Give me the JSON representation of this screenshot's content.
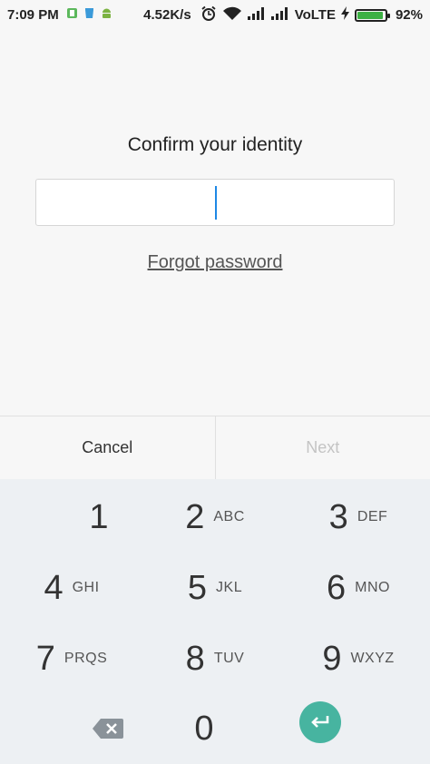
{
  "status_bar": {
    "time": "7:09 PM",
    "net_speed": "4.52K/s",
    "network_label": "VoLTE",
    "battery_percent": "92%",
    "battery_level": 0.92,
    "icons": [
      "notification-green-icon",
      "notification-blue-icon",
      "android-icon",
      "alarm-icon",
      "wifi-icon",
      "signal-icon",
      "signal-icon-2",
      "charging-icon",
      "battery-icon"
    ]
  },
  "prompt": {
    "title": "Confirm your identity",
    "forgot_password": "Forgot password"
  },
  "password_field": {
    "value": ""
  },
  "actions": {
    "cancel": "Cancel",
    "next": "Next"
  },
  "keypad": {
    "keys": [
      {
        "digit": "1",
        "letters": ""
      },
      {
        "digit": "2",
        "letters": "ABC"
      },
      {
        "digit": "3",
        "letters": "DEF"
      },
      {
        "digit": "4",
        "letters": "GHI"
      },
      {
        "digit": "5",
        "letters": "JKL"
      },
      {
        "digit": "6",
        "letters": "MNO"
      },
      {
        "digit": "7",
        "letters": "PRQS"
      },
      {
        "digit": "8",
        "letters": "TUV"
      },
      {
        "digit": "9",
        "letters": "WXYZ"
      },
      {
        "digit": "0",
        "letters": ""
      }
    ],
    "colors": {
      "background": "#edf0f3",
      "enter": "#47b4a0",
      "backspace": "#8a9299"
    }
  }
}
